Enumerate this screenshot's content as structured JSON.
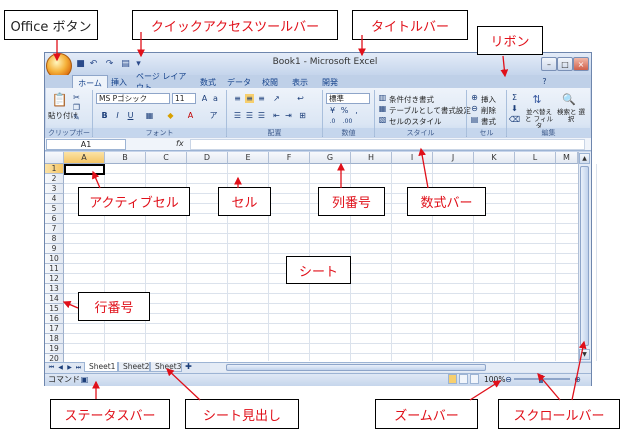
{
  "callouts": {
    "office_button": "Office ボタン",
    "quick_access": "クイックアクセスツールバー",
    "title_bar": "タイトルバー",
    "ribbon": "リボン",
    "active_cell": "アクティブセル",
    "cell": "セル",
    "column_number": "列番号",
    "formula_bar": "数式バー",
    "sheet": "シート",
    "row_number": "行番号",
    "status_bar": "ステータスバー",
    "sheet_tabs": "シート見出し",
    "zoom_bar": "ズームバー",
    "scroll_bar": "スクロールバー"
  },
  "window": {
    "title": "Book1 - Microsoft Excel",
    "controls": [
      "–",
      "□",
      "×"
    ]
  },
  "ribbon": {
    "tabs": [
      "ホーム",
      "挿入",
      "ページ レイアウト",
      "数式",
      "データ",
      "校閲",
      "表示",
      "開発"
    ],
    "paste_label": "貼り付け",
    "font_name": "MS Pゴシック",
    "font_size": "11",
    "number_format": "標準",
    "cond_format": "条件付き書式",
    "table_format": "テーブルとして書式設定",
    "cell_style": "セルのスタイル",
    "insert": "挿入",
    "delete": "削除",
    "format": "書式",
    "sort_filter": "並べ替えと フィルタ",
    "find_select": "検索と 選択",
    "groups": [
      "クリップボード",
      "フォント",
      "配置",
      "数値",
      "スタイル",
      "セル",
      "編集"
    ]
  },
  "formula_bar": {
    "name_box": "A1",
    "fx": "fx",
    "value": ""
  },
  "grid": {
    "columns": [
      "A",
      "B",
      "C",
      "D",
      "E",
      "F",
      "G",
      "H",
      "I",
      "J",
      "K",
      "L",
      "M"
    ],
    "rows": [
      "1",
      "2",
      "3",
      "4",
      "5",
      "6",
      "7",
      "8",
      "9",
      "10",
      "11",
      "12",
      "13",
      "14",
      "15",
      "16",
      "17",
      "18",
      "19",
      "20"
    ],
    "active_cell": "A1"
  },
  "sheets": [
    "Sheet1",
    "Sheet2",
    "Sheet3"
  ],
  "status": {
    "mode": "コマンド",
    "zoom": "100%"
  },
  "colors": {
    "callout_text": "#e0101a",
    "window_bg": "#c6d4ea",
    "selected_header": "#f5c565"
  }
}
